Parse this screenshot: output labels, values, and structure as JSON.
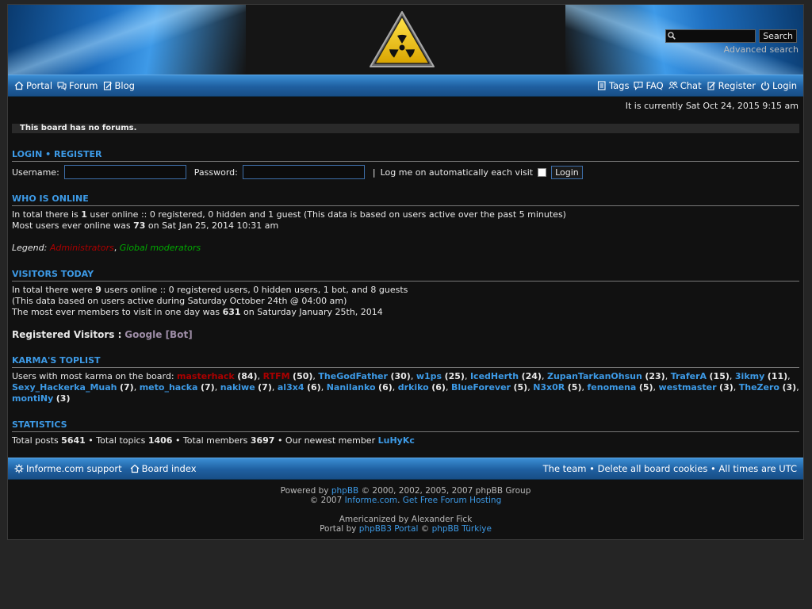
{
  "header": {
    "search_placeholder": "",
    "search_button": "Search",
    "advanced_search": "Advanced search"
  },
  "nav": {
    "left": [
      {
        "label": "Portal",
        "icon": "home-icon"
      },
      {
        "label": "Forum",
        "icon": "forum-icon"
      },
      {
        "label": "Blog",
        "icon": "blog-icon"
      }
    ],
    "right": [
      {
        "label": "Tags",
        "icon": "tags-icon"
      },
      {
        "label": "FAQ",
        "icon": "faq-icon"
      },
      {
        "label": "Chat",
        "icon": "chat-icon"
      },
      {
        "label": "Register",
        "icon": "register-icon"
      },
      {
        "label": "Login",
        "icon": "power-icon"
      }
    ]
  },
  "datebar": "It is currently Sat Oct 24, 2015 9:15 am",
  "no_forums": "This board has no forums.",
  "login": {
    "login_link": "LOGIN",
    "separator": "•",
    "register_link": "REGISTER",
    "username_label": "Username:",
    "password_label": "Password:",
    "pipe": "|",
    "autologin_label": "Log me on automatically each visit",
    "button": "Login"
  },
  "online": {
    "title": "WHO IS ONLINE",
    "line1_a": "In total there is ",
    "line1_count": "1",
    "line1_b": " user online :: 0 registered, 0 hidden and 1 guest (This data is based on users active over the past 5 minutes)",
    "line2_a": "Most users ever online was ",
    "line2_count": "73",
    "line2_b": " on Sat Jan 25, 2014 10:31 am",
    "legend_label": "Legend:",
    "legend_admin": "Administrators",
    "legend_comma": ",",
    "legend_gmod": "Global moderators"
  },
  "visitors": {
    "title": "VISITORS TODAY",
    "line1_a": "In total there were ",
    "line1_count": "9",
    "line1_b": " users online :: 0 registered users, 0 hidden users, 1 bot, and 8 guests",
    "line2": "(This data based on users active during Saturday October 24th @ 04:00 am)",
    "line3_a": "The most ever members to visit in one day was ",
    "line3_count": "631",
    "line3_b": " on Saturday January 25th, 2014",
    "registered_label": "Registered Visitors :",
    "registered_user": "Google [Bot]"
  },
  "karma": {
    "title": "KARMA'S TOPLIST",
    "intro": "Users with most karma on the board:",
    "users": [
      {
        "name": "masterhack",
        "score": "(84)",
        "role": "admin"
      },
      {
        "name": "RTFM",
        "score": "(50)",
        "role": "admin"
      },
      {
        "name": "TheGodFather",
        "score": "(30)",
        "role": "user"
      },
      {
        "name": "w1ps",
        "score": "(25)",
        "role": "user"
      },
      {
        "name": "IcedHerth",
        "score": "(24)",
        "role": "user"
      },
      {
        "name": "ZupanTarkanOhsun",
        "score": "(23)",
        "role": "user"
      },
      {
        "name": "TraferA",
        "score": "(15)",
        "role": "user"
      },
      {
        "name": "3ikmy",
        "score": "(11)",
        "role": "user"
      },
      {
        "name": "Sexy_Hackerka_Muah",
        "score": "(7)",
        "role": "user"
      },
      {
        "name": "meto_hacka",
        "score": "(7)",
        "role": "user"
      },
      {
        "name": "nakiwe",
        "score": "(7)",
        "role": "user"
      },
      {
        "name": "al3x4",
        "score": "(6)",
        "role": "user"
      },
      {
        "name": "Nanilanko",
        "score": "(6)",
        "role": "user"
      },
      {
        "name": "drkiko",
        "score": "(6)",
        "role": "user"
      },
      {
        "name": "BlueForever",
        "score": "(5)",
        "role": "user"
      },
      {
        "name": "N3x0R",
        "score": "(5)",
        "role": "user"
      },
      {
        "name": "fenomena",
        "score": "(5)",
        "role": "user"
      },
      {
        "name": "westmaster",
        "score": "(3)",
        "role": "user"
      },
      {
        "name": "TheZero",
        "score": "(3)",
        "role": "user"
      },
      {
        "name": "montiNy",
        "score": "(3)",
        "role": "user"
      }
    ]
  },
  "stats": {
    "title": "STATISTICS",
    "posts_label": "Total posts ",
    "posts": "5641",
    "topics_label": " • Total topics ",
    "topics": "1406",
    "members_label": " • Total members ",
    "members": "3697",
    "newest_label": " • Our newest member ",
    "newest": "LuHyKc"
  },
  "footer_nav": {
    "support": "Informe.com support",
    "board_index": "Board index",
    "right": "The team • Delete all board cookies • All times are UTC"
  },
  "credits": {
    "powered_a": "Powered by ",
    "phpbb": "phpBB",
    "powered_b": " © 2000, 2002, 2005, 2007 phpBB Group",
    "copy_a": "© 2007 ",
    "informe": "Informe.com",
    "dot": ". ",
    "hosting": "Get Free Forum Hosting",
    "americanized": "Americanized by Alexander Fick",
    "portal_a": "Portal by ",
    "portal_link": "phpBB3 Portal",
    "copy_sym": " © ",
    "turkiye": "phpBB Türkiye"
  }
}
